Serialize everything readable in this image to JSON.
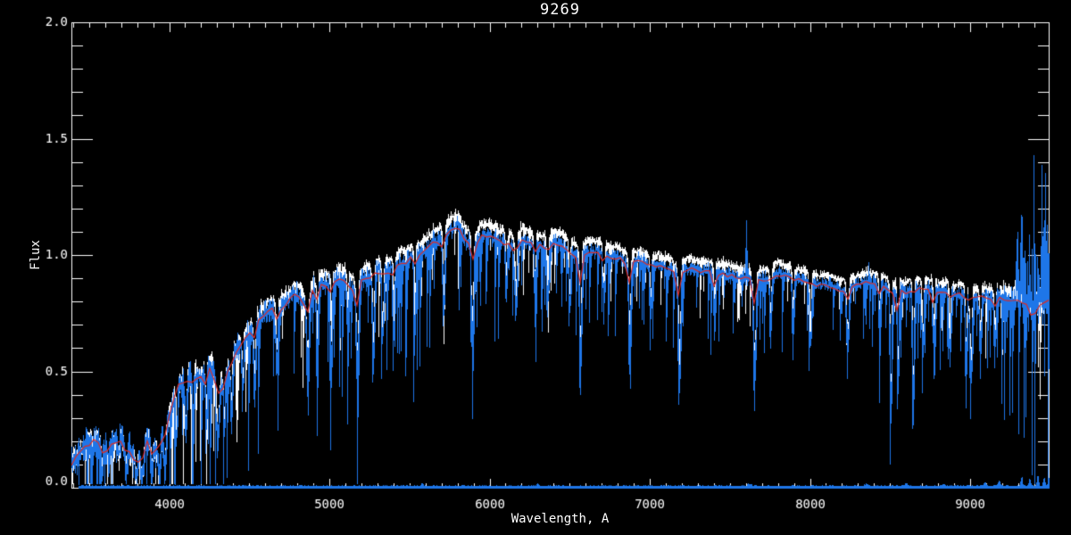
{
  "window": {
    "background": "#000000"
  },
  "chart_data": {
    "type": "line",
    "title": "9269",
    "xlabel": "Wavelength, A",
    "ylabel": "Flux",
    "xlim": [
      3390,
      9490
    ],
    "ylim": [
      0.0,
      2.0
    ],
    "x_major_ticks": [
      {
        "value": 4000,
        "label": "4000"
      },
      {
        "value": 5000,
        "label": "5000"
      },
      {
        "value": 6000,
        "label": "6000"
      },
      {
        "value": 7000,
        "label": "7000"
      },
      {
        "value": 8000,
        "label": "8000"
      },
      {
        "value": 9000,
        "label": "9000"
      }
    ],
    "y_major_ticks": [
      {
        "value": 0.0,
        "label": "0.0"
      },
      {
        "value": 0.5,
        "label": "0.5"
      },
      {
        "value": 1.0,
        "label": "1.0"
      },
      {
        "value": 1.5,
        "label": "1.5"
      },
      {
        "value": 2.0,
        "label": "2.0"
      }
    ],
    "x_minor_step": 100,
    "y_minor_step": 0.1,
    "grid": false,
    "legend_position": "none",
    "colors": {
      "background": "#000000",
      "frame": "#ffffff",
      "text": "#ffffff",
      "observed": "#1e76e8",
      "template": "#ffffff",
      "smoothed": "#dd2c24",
      "error": "#1e76e8"
    },
    "series": [
      {
        "name": "observed-spectrum",
        "color_key": "observed",
        "style": "noisy-line"
      },
      {
        "name": "template-spectrum",
        "color_key": "template",
        "style": "noisy-line"
      },
      {
        "name": "smoothed-spectrum",
        "color_key": "smoothed",
        "style": "smooth-line"
      },
      {
        "name": "error-spectrum",
        "color_key": "error",
        "style": "baseline"
      }
    ],
    "continuum_points": [
      [
        3390,
        0.1
      ],
      [
        3450,
        0.16
      ],
      [
        3500,
        0.19
      ],
      [
        3550,
        0.21
      ],
      [
        3600,
        0.16
      ],
      [
        3650,
        0.19
      ],
      [
        3700,
        0.21
      ],
      [
        3740,
        0.16
      ],
      [
        3780,
        0.13
      ],
      [
        3820,
        0.11
      ],
      [
        3860,
        0.2
      ],
      [
        3900,
        0.16
      ],
      [
        3940,
        0.18
      ],
      [
        3980,
        0.26
      ],
      [
        4020,
        0.36
      ],
      [
        4060,
        0.44
      ],
      [
        4100,
        0.46
      ],
      [
        4140,
        0.48
      ],
      [
        4180,
        0.47
      ],
      [
        4220,
        0.49
      ],
      [
        4260,
        0.52
      ],
      [
        4300,
        0.43
      ],
      [
        4340,
        0.46
      ],
      [
        4400,
        0.56
      ],
      [
        4450,
        0.63
      ],
      [
        4500,
        0.66
      ],
      [
        4550,
        0.71
      ],
      [
        4600,
        0.75
      ],
      [
        4650,
        0.77
      ],
      [
        4700,
        0.77
      ],
      [
        4750,
        0.81
      ],
      [
        4800,
        0.83
      ],
      [
        4850,
        0.78
      ],
      [
        4900,
        0.85
      ],
      [
        4950,
        0.87
      ],
      [
        5000,
        0.87
      ],
      [
        5050,
        0.89
      ],
      [
        5100,
        0.9
      ],
      [
        5150,
        0.85
      ],
      [
        5200,
        0.89
      ],
      [
        5250,
        0.91
      ],
      [
        5300,
        0.93
      ],
      [
        5350,
        0.92
      ],
      [
        5400,
        0.95
      ],
      [
        5450,
        0.96
      ],
      [
        5500,
        0.98
      ],
      [
        5550,
        1.0
      ],
      [
        5600,
        1.02
      ],
      [
        5650,
        1.05
      ],
      [
        5700,
        1.07
      ],
      [
        5750,
        1.1
      ],
      [
        5800,
        1.12
      ],
      [
        5850,
        1.06
      ],
      [
        5900,
        1.04
      ],
      [
        5950,
        1.08
      ],
      [
        6000,
        1.08
      ],
      [
        6050,
        1.06
      ],
      [
        6100,
        1.05
      ],
      [
        6150,
        1.03
      ],
      [
        6200,
        1.06
      ],
      [
        6250,
        1.05
      ],
      [
        6300,
        1.04
      ],
      [
        6350,
        1.03
      ],
      [
        6400,
        1.05
      ],
      [
        6450,
        1.04
      ],
      [
        6500,
        1.02
      ],
      [
        6550,
        0.98
      ],
      [
        6600,
        1.01
      ],
      [
        6650,
        1.01
      ],
      [
        6700,
        1.0
      ],
      [
        6750,
        0.99
      ],
      [
        6800,
        0.99
      ],
      [
        6850,
        0.96
      ],
      [
        6900,
        0.97
      ],
      [
        6950,
        0.97
      ],
      [
        7000,
        0.96
      ],
      [
        7050,
        0.95
      ],
      [
        7100,
        0.94
      ],
      [
        7150,
        0.92
      ],
      [
        7200,
        0.93
      ],
      [
        7250,
        0.94
      ],
      [
        7300,
        0.93
      ],
      [
        7350,
        0.93
      ],
      [
        7400,
        0.92
      ],
      [
        7450,
        0.92
      ],
      [
        7500,
        0.91
      ],
      [
        7550,
        0.9
      ],
      [
        7600,
        0.9
      ],
      [
        7650,
        0.88
      ],
      [
        7700,
        0.89
      ],
      [
        7750,
        0.9
      ],
      [
        7800,
        0.92
      ],
      [
        7850,
        0.91
      ],
      [
        7900,
        0.9
      ],
      [
        7950,
        0.89
      ],
      [
        8000,
        0.88
      ],
      [
        8050,
        0.87
      ],
      [
        8100,
        0.87
      ],
      [
        8150,
        0.86
      ],
      [
        8200,
        0.85
      ],
      [
        8250,
        0.86
      ],
      [
        8300,
        0.87
      ],
      [
        8350,
        0.88
      ],
      [
        8400,
        0.88
      ],
      [
        8450,
        0.87
      ],
      [
        8500,
        0.84
      ],
      [
        8550,
        0.85
      ],
      [
        8600,
        0.84
      ],
      [
        8650,
        0.85
      ],
      [
        8700,
        0.86
      ],
      [
        8750,
        0.85
      ],
      [
        8800,
        0.84
      ],
      [
        8850,
        0.84
      ],
      [
        8900,
        0.83
      ],
      [
        8950,
        0.83
      ],
      [
        9000,
        0.82
      ],
      [
        9050,
        0.82
      ],
      [
        9100,
        0.82
      ],
      [
        9150,
        0.81
      ],
      [
        9200,
        0.81
      ],
      [
        9250,
        0.8
      ],
      [
        9300,
        0.8
      ],
      [
        9350,
        0.78
      ],
      [
        9390,
        0.74
      ],
      [
        9430,
        0.78
      ],
      [
        9490,
        0.8
      ]
    ],
    "absorption_lines": [
      [
        3580,
        0.6,
        10
      ],
      [
        3620,
        0.45,
        8
      ],
      [
        3680,
        0.4,
        8
      ],
      [
        3730,
        0.55,
        10
      ],
      [
        3790,
        0.6,
        10
      ],
      [
        3830,
        0.7,
        10
      ],
      [
        3890,
        0.65,
        9
      ],
      [
        3935,
        0.7,
        9
      ],
      [
        3970,
        0.65,
        9
      ],
      [
        4045,
        0.4,
        7
      ],
      [
        4101,
        0.45,
        9
      ],
      [
        4145,
        0.4,
        7
      ],
      [
        4227,
        0.5,
        7
      ],
      [
        4300,
        0.5,
        12
      ],
      [
        4340,
        0.4,
        7
      ],
      [
        4385,
        0.45,
        7
      ],
      [
        4455,
        0.35,
        7
      ],
      [
        4530,
        0.35,
        9
      ],
      [
        4668,
        0.3,
        9
      ],
      [
        4861,
        0.4,
        9
      ],
      [
        4920,
        0.28,
        7
      ],
      [
        5010,
        0.28,
        7
      ],
      [
        5110,
        0.25,
        7
      ],
      [
        5170,
        0.45,
        10
      ],
      [
        5270,
        0.4,
        9
      ],
      [
        5330,
        0.28,
        7
      ],
      [
        5400,
        0.25,
        7
      ],
      [
        5530,
        0.28,
        7
      ],
      [
        5710,
        0.28,
        9
      ],
      [
        5890,
        0.4,
        9
      ],
      [
        6100,
        0.22,
        7
      ],
      [
        6160,
        0.28,
        9
      ],
      [
        6280,
        0.25,
        7
      ],
      [
        6360,
        0.22,
        7
      ],
      [
        6495,
        0.28,
        7
      ],
      [
        6563,
        0.55,
        8
      ],
      [
        6710,
        0.22,
        7
      ],
      [
        6870,
        0.4,
        9
      ],
      [
        7000,
        0.28,
        7
      ],
      [
        7180,
        0.5,
        10
      ],
      [
        7400,
        0.25,
        7
      ],
      [
        7650,
        0.5,
        10
      ],
      [
        7750,
        0.28,
        7
      ],
      [
        7890,
        0.3,
        7
      ],
      [
        8000,
        0.28,
        7
      ],
      [
        8230,
        0.35,
        9
      ],
      [
        8430,
        0.25,
        7
      ],
      [
        8500,
        0.7,
        7
      ],
      [
        8545,
        0.5,
        7
      ],
      [
        8640,
        0.7,
        7
      ],
      [
        8700,
        0.4,
        7
      ],
      [
        8770,
        0.35,
        7
      ],
      [
        8870,
        0.3,
        7
      ],
      [
        8970,
        0.5,
        7
      ],
      [
        9000,
        0.5,
        9
      ],
      [
        9060,
        0.35,
        7
      ],
      [
        9150,
        0.3,
        7
      ]
    ],
    "emission_spikes": [
      [
        7600,
        0.24,
        5
      ],
      [
        8365,
        0.1,
        4
      ],
      [
        9320,
        0.95,
        3
      ],
      [
        9342,
        0.4,
        3
      ],
      [
        9365,
        0.3,
        3
      ],
      [
        9395,
        0.62,
        3
      ],
      [
        9420,
        0.45,
        3
      ],
      [
        9447,
        0.78,
        3
      ],
      [
        9468,
        0.55,
        3
      ],
      [
        9487,
        0.5,
        3
      ]
    ],
    "noise_envelope": [
      [
        3390,
        0.07
      ],
      [
        3600,
        0.075
      ],
      [
        3900,
        0.08
      ],
      [
        4100,
        0.07
      ],
      [
        4400,
        0.06
      ],
      [
        4700,
        0.055
      ],
      [
        5000,
        0.05
      ],
      [
        5400,
        0.045
      ],
      [
        5800,
        0.04
      ],
      [
        6200,
        0.035
      ],
      [
        6600,
        0.033
      ],
      [
        7000,
        0.032
      ],
      [
        7400,
        0.033
      ],
      [
        7800,
        0.03
      ],
      [
        8200,
        0.028
      ],
      [
        8600,
        0.03
      ],
      [
        9000,
        0.035
      ],
      [
        9200,
        0.045
      ],
      [
        9300,
        0.07
      ],
      [
        9400,
        0.09
      ],
      [
        9490,
        0.09
      ]
    ],
    "error_baseline": 0.006,
    "error_bumps": [
      [
        5577,
        0.012,
        10
      ],
      [
        6300,
        0.008,
        10
      ],
      [
        7620,
        0.01,
        15
      ],
      [
        8350,
        0.008,
        15
      ],
      [
        8600,
        0.01,
        15
      ],
      [
        8830,
        0.008,
        12
      ],
      [
        9090,
        0.015,
        12
      ],
      [
        9180,
        0.02,
        12
      ],
      [
        9320,
        0.045,
        8
      ],
      [
        9370,
        0.03,
        8
      ],
      [
        9420,
        0.05,
        8
      ],
      [
        9460,
        0.045,
        8
      ],
      [
        9487,
        0.04,
        6
      ]
    ]
  }
}
